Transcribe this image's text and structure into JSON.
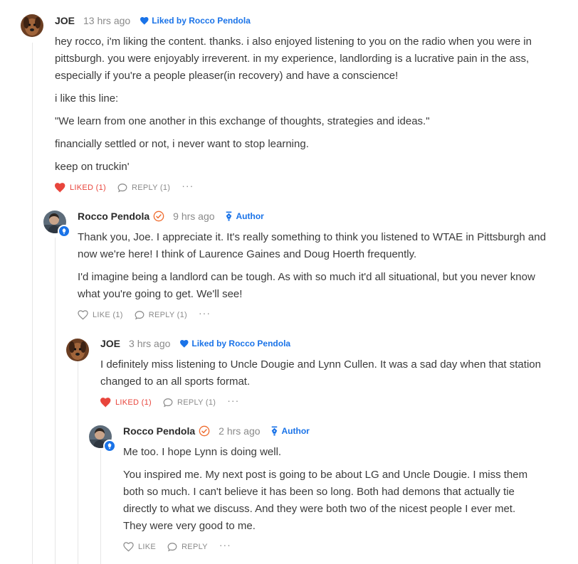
{
  "accent_color": "#1a73e8",
  "liked_color": "#e8453c",
  "comments": [
    {
      "author": "JOE",
      "time": "13 hrs ago",
      "liked_by": "Liked by Rocco Pendola",
      "paragraphs": [
        "hey rocco, i'm liking the content. thanks. i also enjoyed listening to you on the radio when you were in pittsburgh. you were enjoyably irreverent. in my experience, landlording is a lucrative pain in the ass, especially if you're a people pleaser(in recovery) and have a conscience!",
        "i like this line:",
        "\"We learn from one another in this exchange of thoughts, strategies and ideas.\"",
        "financially settled or not, i never want to stop learning.",
        "keep on truckin'"
      ],
      "like_label": "LIKED (1)",
      "reply_label": "REPLY (1)",
      "more_label": "···"
    },
    {
      "author": "Rocco Pendola",
      "time": "9 hrs ago",
      "author_tag": "Author",
      "paragraphs": [
        "Thank you, Joe. I appreciate it. It's really something to think you listened to WTAE in Pittsburgh and now we're here! I think of Laurence Gaines and Doug Hoerth frequently.",
        "I'd imagine being a landlord can be tough. As with so much it'd all situational, but you never know what you're going to get. We'll see!"
      ],
      "like_label": "LIKE (1)",
      "reply_label": "REPLY (1)",
      "more_label": "···"
    },
    {
      "author": "JOE",
      "time": "3 hrs ago",
      "liked_by": "Liked by Rocco Pendola",
      "paragraphs": [
        "I definitely miss listening to Uncle Dougie and Lynn Cullen. It was a sad day when that station changed to an all sports format."
      ],
      "like_label": "LIKED (1)",
      "reply_label": "REPLY (1)",
      "more_label": "···"
    },
    {
      "author": "Rocco Pendola",
      "time": "2 hrs ago",
      "author_tag": "Author",
      "paragraphs": [
        "Me too. I hope Lynn is doing well.",
        "You inspired me. My next post is going to be about LG and Uncle Dougie. I miss them both so much. I can't believe it has been so long. Both had demons that actually tie directly to what we discuss. And they were both two of the nicest people I ever met. They were very good to me."
      ],
      "like_label": "LIKE",
      "reply_label": "REPLY",
      "more_label": "···"
    }
  ]
}
